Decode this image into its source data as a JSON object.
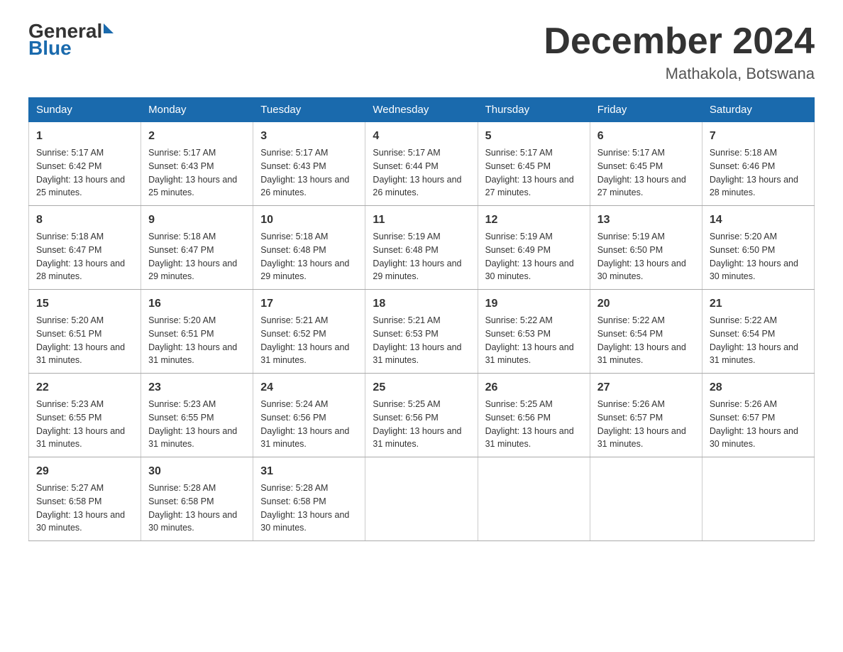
{
  "header": {
    "logo_general": "General",
    "logo_blue": "Blue",
    "month_title": "December 2024",
    "location": "Mathakola, Botswana"
  },
  "days_of_week": [
    "Sunday",
    "Monday",
    "Tuesday",
    "Wednesday",
    "Thursday",
    "Friday",
    "Saturday"
  ],
  "weeks": [
    [
      {
        "day": "1",
        "sunrise": "5:17 AM",
        "sunset": "6:42 PM",
        "daylight": "13 hours and 25 minutes."
      },
      {
        "day": "2",
        "sunrise": "5:17 AM",
        "sunset": "6:43 PM",
        "daylight": "13 hours and 25 minutes."
      },
      {
        "day": "3",
        "sunrise": "5:17 AM",
        "sunset": "6:43 PM",
        "daylight": "13 hours and 26 minutes."
      },
      {
        "day": "4",
        "sunrise": "5:17 AM",
        "sunset": "6:44 PM",
        "daylight": "13 hours and 26 minutes."
      },
      {
        "day": "5",
        "sunrise": "5:17 AM",
        "sunset": "6:45 PM",
        "daylight": "13 hours and 27 minutes."
      },
      {
        "day": "6",
        "sunrise": "5:17 AM",
        "sunset": "6:45 PM",
        "daylight": "13 hours and 27 minutes."
      },
      {
        "day": "7",
        "sunrise": "5:18 AM",
        "sunset": "6:46 PM",
        "daylight": "13 hours and 28 minutes."
      }
    ],
    [
      {
        "day": "8",
        "sunrise": "5:18 AM",
        "sunset": "6:47 PM",
        "daylight": "13 hours and 28 minutes."
      },
      {
        "day": "9",
        "sunrise": "5:18 AM",
        "sunset": "6:47 PM",
        "daylight": "13 hours and 29 minutes."
      },
      {
        "day": "10",
        "sunrise": "5:18 AM",
        "sunset": "6:48 PM",
        "daylight": "13 hours and 29 minutes."
      },
      {
        "day": "11",
        "sunrise": "5:19 AM",
        "sunset": "6:48 PM",
        "daylight": "13 hours and 29 minutes."
      },
      {
        "day": "12",
        "sunrise": "5:19 AM",
        "sunset": "6:49 PM",
        "daylight": "13 hours and 30 minutes."
      },
      {
        "day": "13",
        "sunrise": "5:19 AM",
        "sunset": "6:50 PM",
        "daylight": "13 hours and 30 minutes."
      },
      {
        "day": "14",
        "sunrise": "5:20 AM",
        "sunset": "6:50 PM",
        "daylight": "13 hours and 30 minutes."
      }
    ],
    [
      {
        "day": "15",
        "sunrise": "5:20 AM",
        "sunset": "6:51 PM",
        "daylight": "13 hours and 31 minutes."
      },
      {
        "day": "16",
        "sunrise": "5:20 AM",
        "sunset": "6:51 PM",
        "daylight": "13 hours and 31 minutes."
      },
      {
        "day": "17",
        "sunrise": "5:21 AM",
        "sunset": "6:52 PM",
        "daylight": "13 hours and 31 minutes."
      },
      {
        "day": "18",
        "sunrise": "5:21 AM",
        "sunset": "6:53 PM",
        "daylight": "13 hours and 31 minutes."
      },
      {
        "day": "19",
        "sunrise": "5:22 AM",
        "sunset": "6:53 PM",
        "daylight": "13 hours and 31 minutes."
      },
      {
        "day": "20",
        "sunrise": "5:22 AM",
        "sunset": "6:54 PM",
        "daylight": "13 hours and 31 minutes."
      },
      {
        "day": "21",
        "sunrise": "5:22 AM",
        "sunset": "6:54 PM",
        "daylight": "13 hours and 31 minutes."
      }
    ],
    [
      {
        "day": "22",
        "sunrise": "5:23 AM",
        "sunset": "6:55 PM",
        "daylight": "13 hours and 31 minutes."
      },
      {
        "day": "23",
        "sunrise": "5:23 AM",
        "sunset": "6:55 PM",
        "daylight": "13 hours and 31 minutes."
      },
      {
        "day": "24",
        "sunrise": "5:24 AM",
        "sunset": "6:56 PM",
        "daylight": "13 hours and 31 minutes."
      },
      {
        "day": "25",
        "sunrise": "5:25 AM",
        "sunset": "6:56 PM",
        "daylight": "13 hours and 31 minutes."
      },
      {
        "day": "26",
        "sunrise": "5:25 AM",
        "sunset": "6:56 PM",
        "daylight": "13 hours and 31 minutes."
      },
      {
        "day": "27",
        "sunrise": "5:26 AM",
        "sunset": "6:57 PM",
        "daylight": "13 hours and 31 minutes."
      },
      {
        "day": "28",
        "sunrise": "5:26 AM",
        "sunset": "6:57 PM",
        "daylight": "13 hours and 30 minutes."
      }
    ],
    [
      {
        "day": "29",
        "sunrise": "5:27 AM",
        "sunset": "6:58 PM",
        "daylight": "13 hours and 30 minutes."
      },
      {
        "day": "30",
        "sunrise": "5:28 AM",
        "sunset": "6:58 PM",
        "daylight": "13 hours and 30 minutes."
      },
      {
        "day": "31",
        "sunrise": "5:28 AM",
        "sunset": "6:58 PM",
        "daylight": "13 hours and 30 minutes."
      },
      null,
      null,
      null,
      null
    ]
  ],
  "labels": {
    "sunrise": "Sunrise:",
    "sunset": "Sunset:",
    "daylight": "Daylight:"
  }
}
